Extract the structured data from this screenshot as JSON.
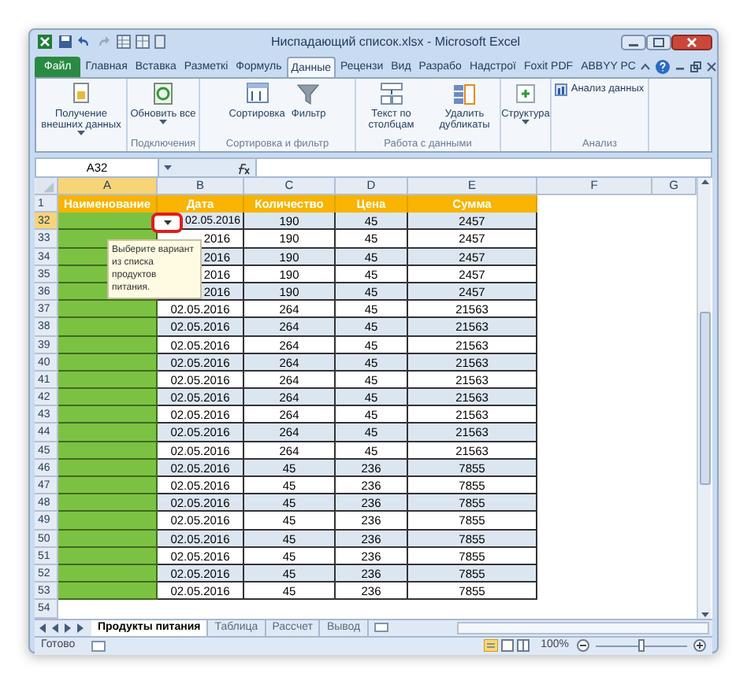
{
  "window": {
    "title": "Ниспадающий список.xlsx - Microsoft Excel"
  },
  "tabs": [
    {
      "label": "Файл",
      "kind": "file",
      "selected": false
    },
    {
      "label": "Главная",
      "selected": false
    },
    {
      "label": "Вставка",
      "selected": false
    },
    {
      "label": "Разметкі",
      "selected": false
    },
    {
      "label": "Формуль",
      "selected": false
    },
    {
      "label": "Данные",
      "selected": true
    },
    {
      "label": "Рецензи",
      "selected": false
    },
    {
      "label": "Вид",
      "selected": false
    },
    {
      "label": "Разрабо",
      "selected": false
    },
    {
      "label": "Надстрої",
      "selected": false
    },
    {
      "label": "Foxit PDF",
      "selected": false
    },
    {
      "label": "ABBYY PC",
      "selected": false
    }
  ],
  "ribbon": {
    "groups": [
      {
        "buttons": [
          {
            "label": "Получение внешних данных",
            "kind": "large",
            "dropdown": true
          }
        ]
      },
      {
        "label": "Подключения",
        "buttons": [
          {
            "label": "Обновить все",
            "kind": "large",
            "dropdown": true
          }
        ]
      },
      {
        "label": "Сортировка и фильтр",
        "buttons": [
          {
            "label": "Сортировка",
            "kind": "large",
            "dropdown": false
          },
          {
            "label": "Фильтр",
            "kind": "large",
            "dropdown": false
          }
        ]
      },
      {
        "label": "Работа с данными",
        "buttons": [
          {
            "label": "Текст по столбцам",
            "kind": "large",
            "dropdown": false
          },
          {
            "label": "Удалить дубликаты",
            "kind": "large",
            "dropdown": false
          }
        ]
      },
      {
        "buttons": [
          {
            "label": "Структура",
            "kind": "large",
            "dropdown": true
          }
        ]
      },
      {
        "label": "Анализ",
        "buttons": [
          {
            "label": "Анализ данных",
            "kind": "small",
            "dropdown": false
          }
        ]
      }
    ]
  },
  "formula_bar": {
    "name_box": "A32"
  },
  "columns": [
    {
      "label": "A",
      "selected": true
    },
    {
      "label": "B",
      "selected": false
    },
    {
      "label": "C",
      "selected": false
    },
    {
      "label": "D",
      "selected": false
    },
    {
      "label": "E",
      "selected": false
    },
    {
      "label": "F",
      "selected": false
    },
    {
      "label": "G",
      "selected": false
    }
  ],
  "rows": [
    {
      "row": "1",
      "kind": "header",
      "selected": false,
      "headers": [
        "Наименование",
        "Дата",
        "Количество",
        "Цена",
        "Сумма"
      ]
    },
    {
      "row": "32",
      "kind": "data",
      "selected": true,
      "date": "02.05.2016",
      "quantity": "190",
      "price": "45",
      "sum": "2457"
    },
    {
      "row": "33",
      "kind": "data",
      "selected": false,
      "date": "2016",
      "quantity": "190",
      "price": "45",
      "sum": "2457"
    },
    {
      "row": "34",
      "kind": "data",
      "selected": false,
      "date": "2016",
      "quantity": "190",
      "price": "45",
      "sum": "2457"
    },
    {
      "row": "35",
      "kind": "data",
      "selected": false,
      "date": "2016",
      "quantity": "190",
      "price": "45",
      "sum": "2457"
    },
    {
      "row": "36",
      "kind": "data",
      "selected": false,
      "date": "2016",
      "quantity": "190",
      "price": "45",
      "sum": "2457"
    },
    {
      "row": "37",
      "kind": "data",
      "selected": false,
      "date": "02.05.2016",
      "quantity": "264",
      "price": "45",
      "sum": "21563"
    },
    {
      "row": "38",
      "kind": "data",
      "selected": false,
      "date": "02.05.2016",
      "quantity": "264",
      "price": "45",
      "sum": "21563"
    },
    {
      "row": "39",
      "kind": "data",
      "selected": false,
      "date": "02.05.2016",
      "quantity": "264",
      "price": "45",
      "sum": "21563"
    },
    {
      "row": "40",
      "kind": "data",
      "selected": false,
      "date": "02.05.2016",
      "quantity": "264",
      "price": "45",
      "sum": "21563"
    },
    {
      "row": "41",
      "kind": "data",
      "selected": false,
      "date": "02.05.2016",
      "quantity": "264",
      "price": "45",
      "sum": "21563"
    },
    {
      "row": "42",
      "kind": "data",
      "selected": false,
      "date": "02.05.2016",
      "quantity": "264",
      "price": "45",
      "sum": "21563"
    },
    {
      "row": "43",
      "kind": "data",
      "selected": false,
      "date": "02.05.2016",
      "quantity": "264",
      "price": "45",
      "sum": "21563"
    },
    {
      "row": "44",
      "kind": "data",
      "selected": false,
      "date": "02.05.2016",
      "quantity": "264",
      "price": "45",
      "sum": "21563"
    },
    {
      "row": "45",
      "kind": "data",
      "selected": false,
      "date": "02.05.2016",
      "quantity": "264",
      "price": "45",
      "sum": "21563"
    },
    {
      "row": "46",
      "kind": "data",
      "selected": false,
      "date": "02.05.2016",
      "quantity": "45",
      "price": "236",
      "sum": "7855"
    },
    {
      "row": "47",
      "kind": "data",
      "selected": false,
      "date": "02.05.2016",
      "quantity": "45",
      "price": "236",
      "sum": "7855"
    },
    {
      "row": "48",
      "kind": "data",
      "selected": false,
      "date": "02.05.2016",
      "quantity": "45",
      "price": "236",
      "sum": "7855"
    },
    {
      "row": "49",
      "kind": "data",
      "selected": false,
      "date": "02.05.2016",
      "quantity": "45",
      "price": "236",
      "sum": "7855"
    },
    {
      "row": "50",
      "kind": "data",
      "selected": false,
      "date": "02.05.2016",
      "quantity": "45",
      "price": "236",
      "sum": "7855"
    },
    {
      "row": "51",
      "kind": "data",
      "selected": false,
      "date": "02.05.2016",
      "quantity": "45",
      "price": "236",
      "sum": "7855"
    },
    {
      "row": "52",
      "kind": "data",
      "selected": false,
      "date": "02.05.2016",
      "quantity": "45",
      "price": "236",
      "sum": "7855"
    },
    {
      "row": "53",
      "kind": "data",
      "selected": false,
      "date": "02.05.2016",
      "quantity": "45",
      "price": "236",
      "sum": "7855"
    },
    {
      "row": "54",
      "kind": "empty",
      "selected": false
    }
  ],
  "tooltip": {
    "text": "Выберите вариант из списка продуктов питания."
  },
  "sheet_tabs": [
    {
      "label": "Продукты питания",
      "selected": true
    },
    {
      "label": "Таблица",
      "selected": false
    },
    {
      "label": "Рассчет",
      "selected": false
    },
    {
      "label": "Вывод",
      "selected": false
    }
  ],
  "status_bar": {
    "status": "Готово",
    "zoom": "100%",
    "zoom_level": {
      "level": 0.5
    }
  }
}
